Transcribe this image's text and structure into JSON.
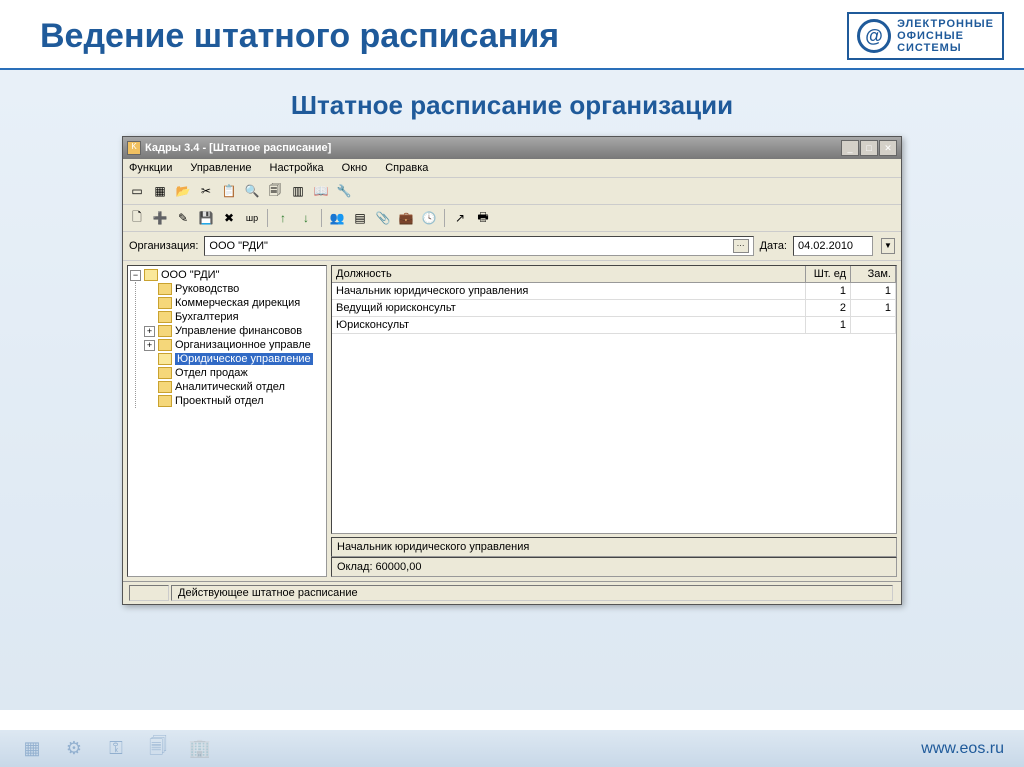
{
  "slide": {
    "title": "Ведение штатного расписания",
    "subtitle": "Штатное расписание организации",
    "logo": {
      "line1": "ЭЛЕКТРОННЫЕ",
      "line2": "ОФИСНЫЕ",
      "line3": "СИСТЕМЫ"
    },
    "footer_url": "www.eos.ru"
  },
  "app": {
    "title": "Кадры 3.4 - [Штатное расписание]",
    "menu": [
      "Функции",
      "Управление",
      "Настройка",
      "Окно",
      "Справка"
    ],
    "filter": {
      "org_label": "Организация:",
      "org_value": "ООО \"РДИ\"",
      "date_label": "Дата:",
      "date_value": "04.02.2010"
    },
    "tree": {
      "root": "ООО \"РДИ\"",
      "items": [
        "Руководство",
        "Коммерческая дирекция",
        "Бухгалтерия",
        "Управление финансовов",
        "Организационное управле",
        "Юридическое управление",
        "Отдел продаж",
        "Аналитический отдел",
        "Проектный отдел"
      ],
      "selected_index": 5,
      "expandable": [
        3,
        4
      ]
    },
    "grid": {
      "headers": {
        "position": "Должность",
        "count": "Шт. ед",
        "sub": "Зам."
      },
      "rows": [
        {
          "position": "Начальник юридического управления",
          "count": "1",
          "sub": "1"
        },
        {
          "position": "Ведущий юрисконсульт",
          "count": "2",
          "sub": "1"
        },
        {
          "position": "Юрисконсульт",
          "count": "1",
          "sub": ""
        }
      ]
    },
    "detail": {
      "position": "Начальник юридического управления",
      "salary": "Оклад: 60000,00"
    },
    "statusbar": "Действующее штатное расписание"
  }
}
